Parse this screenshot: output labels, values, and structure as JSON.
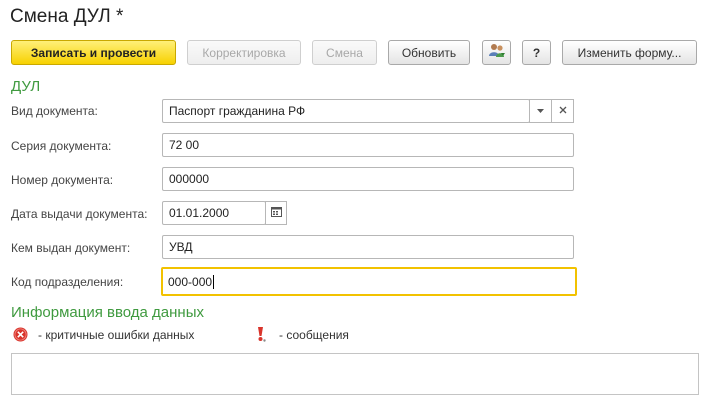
{
  "window": {
    "title": "Смена ДУЛ *"
  },
  "toolbar": {
    "post_label": "Записать и провести",
    "correction_label": "Корректировка",
    "change_label": "Смена",
    "refresh_label": "Обновить",
    "help_label": "?",
    "change_form_label": "Изменить форму..."
  },
  "form": {
    "section_title": "ДУЛ",
    "doc_type": {
      "label": "Вид документа:",
      "value": "Паспорт гражданина РФ"
    },
    "series": {
      "label": "Серия документа:",
      "value": "72 00"
    },
    "number": {
      "label": "Номер документа:",
      "value": "000000"
    },
    "issue_date": {
      "label": "Дата выдачи документа:",
      "value": "01.01.2000"
    },
    "issued_by": {
      "label": "Кем выдан документ:",
      "value": "УВД"
    },
    "subdivision_code": {
      "label": "Код подразделения:",
      "value": "000-000"
    }
  },
  "info": {
    "title": "Информация ввода данных",
    "critical_label": "- критичные ошибки данных",
    "messages_label": "- сообщения"
  },
  "colors": {
    "accent_green": "#3f9a3f",
    "primary_button": "#f7d100",
    "focus_border": "#f2c200",
    "error_red": "#d9342b"
  },
  "icons": {
    "users": "users-icon",
    "dropdown": "chevron-down-icon",
    "clear": "clear-x-icon",
    "calendar": "calendar-icon",
    "error": "error-circle-icon",
    "message": "exclamation-icon"
  }
}
